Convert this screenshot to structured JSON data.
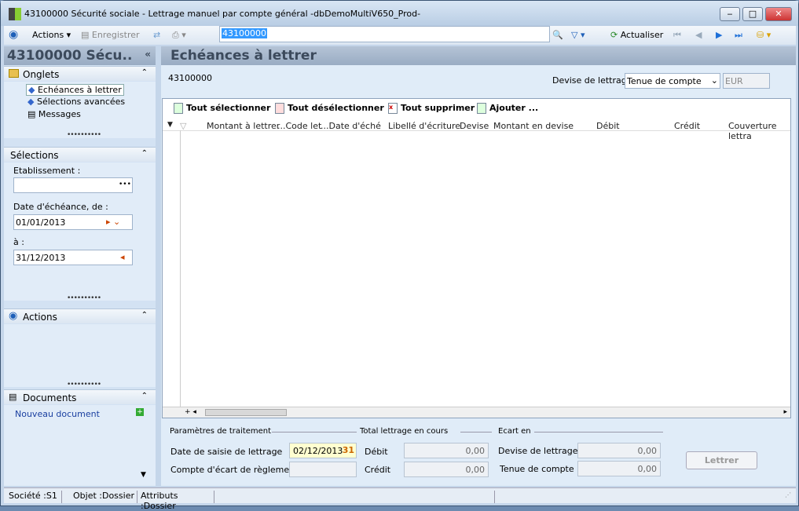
{
  "window": {
    "title": "43100000 Sécurité sociale -  Lettrage manuel par compte général -dbDemoMultiV650_Prod-"
  },
  "toolbar": {
    "actions": "Actions",
    "save": "Enregistrer",
    "search_value": "43100000",
    "refresh": "Actualiser"
  },
  "left": {
    "title": "43100000 Sécu..",
    "onglets": {
      "label": "Onglets",
      "items": [
        "Echéances à lettrer",
        "Sélections avancées",
        "Messages"
      ]
    },
    "selections": {
      "label": "Sélections",
      "etablissement_label": "Etablissement :",
      "etablissement_value": "",
      "date_from_label": "Date d'échéance, de :",
      "date_from": "01/01/2013",
      "date_to_label": "à :",
      "date_to": "31/12/2013"
    },
    "actions": {
      "label": "Actions"
    },
    "documents": {
      "label": "Documents",
      "new": "Nouveau document"
    }
  },
  "main": {
    "title": "Echéances à lettrer",
    "account": "43100000",
    "currency_label": "Devise de lettrage :",
    "currency_select": "Tenue de compte",
    "currency_code": "EUR",
    "grid_toolbar": [
      "Tout sélectionner",
      "Tout désélectionner",
      "Tout supprimer",
      "Ajouter ..."
    ],
    "columns": [
      "Montant à lettrer",
      "...Code let",
      "...Date d'éché",
      "Libellé d'écriture",
      "Devise",
      "Montant en devise",
      "Débit",
      "Crédit",
      "Couverture lettra"
    ]
  },
  "bottom": {
    "params_label": "Paramètres de traitement",
    "date_label": "Date de saisie de lettrage",
    "date_value": "02/12/2013",
    "ecart_account_label": "Compte d'écart de règlement",
    "total_label": "Total lettrage en cours",
    "debit_label": "Débit",
    "debit": "0,00",
    "credit_label": "Crédit",
    "credit": "0,00",
    "ecart_label": "Ecart en",
    "devise_label": "Devise de lettrage",
    "devise": "0,00",
    "tenue_label": "Tenue de compte",
    "tenue": "0,00",
    "button": "Lettrer"
  },
  "status": {
    "societe": "Société :S1",
    "objet": "Objet :Dossier",
    "attributs": "Attributs :Dossier"
  }
}
